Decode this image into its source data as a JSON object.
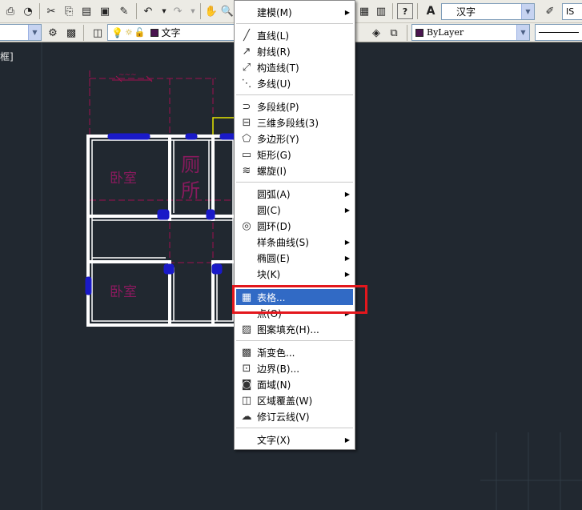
{
  "toolbar_top": {
    "icons": [
      "publish-icon",
      "plot-preview-icon",
      "cut-icon",
      "copy-icon",
      "paste-icon",
      "match-properties-icon",
      "brush-icon",
      "undo-icon",
      "redo-icon",
      "pan-icon",
      "zoom-icon"
    ],
    "right_icons": [
      "calculator-icon",
      "help-icon"
    ],
    "text_style_value": "汉字",
    "dim_style_value": "IS"
  },
  "toolbar_layers": {
    "layer_value": "文字",
    "color_value": "ByLayer"
  },
  "viewport_label": "框]",
  "drawing_labels": {
    "room1": "卧室",
    "room2": "厕",
    "room3": "所",
    "room4": "卧室"
  },
  "draw_menu": {
    "items": [
      {
        "label": "建模(M)",
        "icon": "",
        "submenu": true
      },
      {
        "label": "直线(L)",
        "icon": "line-icon",
        "submenu": false
      },
      {
        "label": "射线(R)",
        "icon": "ray-icon",
        "submenu": false
      },
      {
        "label": "构造线(T)",
        "icon": "xline-icon",
        "submenu": false
      },
      {
        "label": "多线(U)",
        "icon": "mline-icon",
        "submenu": false
      },
      {
        "label": "多段线(P)",
        "icon": "polyline-icon",
        "submenu": false
      },
      {
        "label": "三维多段线(3)",
        "icon": "3dpoly-icon",
        "submenu": false
      },
      {
        "label": "多边形(Y)",
        "icon": "polygon-icon",
        "submenu": false
      },
      {
        "label": "矩形(G)",
        "icon": "rectangle-icon",
        "submenu": false
      },
      {
        "label": "螺旋(I)",
        "icon": "helix-icon",
        "submenu": false
      },
      {
        "label": "圆弧(A)",
        "icon": "",
        "submenu": true
      },
      {
        "label": "圆(C)",
        "icon": "",
        "submenu": true
      },
      {
        "label": "圆环(D)",
        "icon": "donut-icon",
        "submenu": false
      },
      {
        "label": "样条曲线(S)",
        "icon": "",
        "submenu": true
      },
      {
        "label": "椭圆(E)",
        "icon": "",
        "submenu": true
      },
      {
        "label": "块(K)",
        "icon": "",
        "submenu": true
      },
      {
        "label": "表格...",
        "icon": "table-icon",
        "submenu": false
      },
      {
        "label": "点(O)",
        "icon": "",
        "submenu": true
      },
      {
        "label": "图案填充(H)...",
        "icon": "hatch-icon",
        "submenu": false
      },
      {
        "label": "渐变色...",
        "icon": "gradient-icon",
        "submenu": false
      },
      {
        "label": "边界(B)...",
        "icon": "boundary-icon",
        "submenu": false
      },
      {
        "label": "面域(N)",
        "icon": "region-icon",
        "submenu": false
      },
      {
        "label": "区域覆盖(W)",
        "icon": "wipeout-icon",
        "submenu": false
      },
      {
        "label": "修订云线(V)",
        "icon": "revcloud-icon",
        "submenu": false
      },
      {
        "label": "文字(X)",
        "icon": "",
        "submenu": true
      }
    ],
    "highlighted": "表格..."
  },
  "colors": {
    "canvas": "#212830",
    "wall": "#ffffff",
    "annotation": "#a01050",
    "window_blue": "#1a1ac8",
    "highlight": "#316ac5",
    "callout_red": "#e3171d"
  }
}
